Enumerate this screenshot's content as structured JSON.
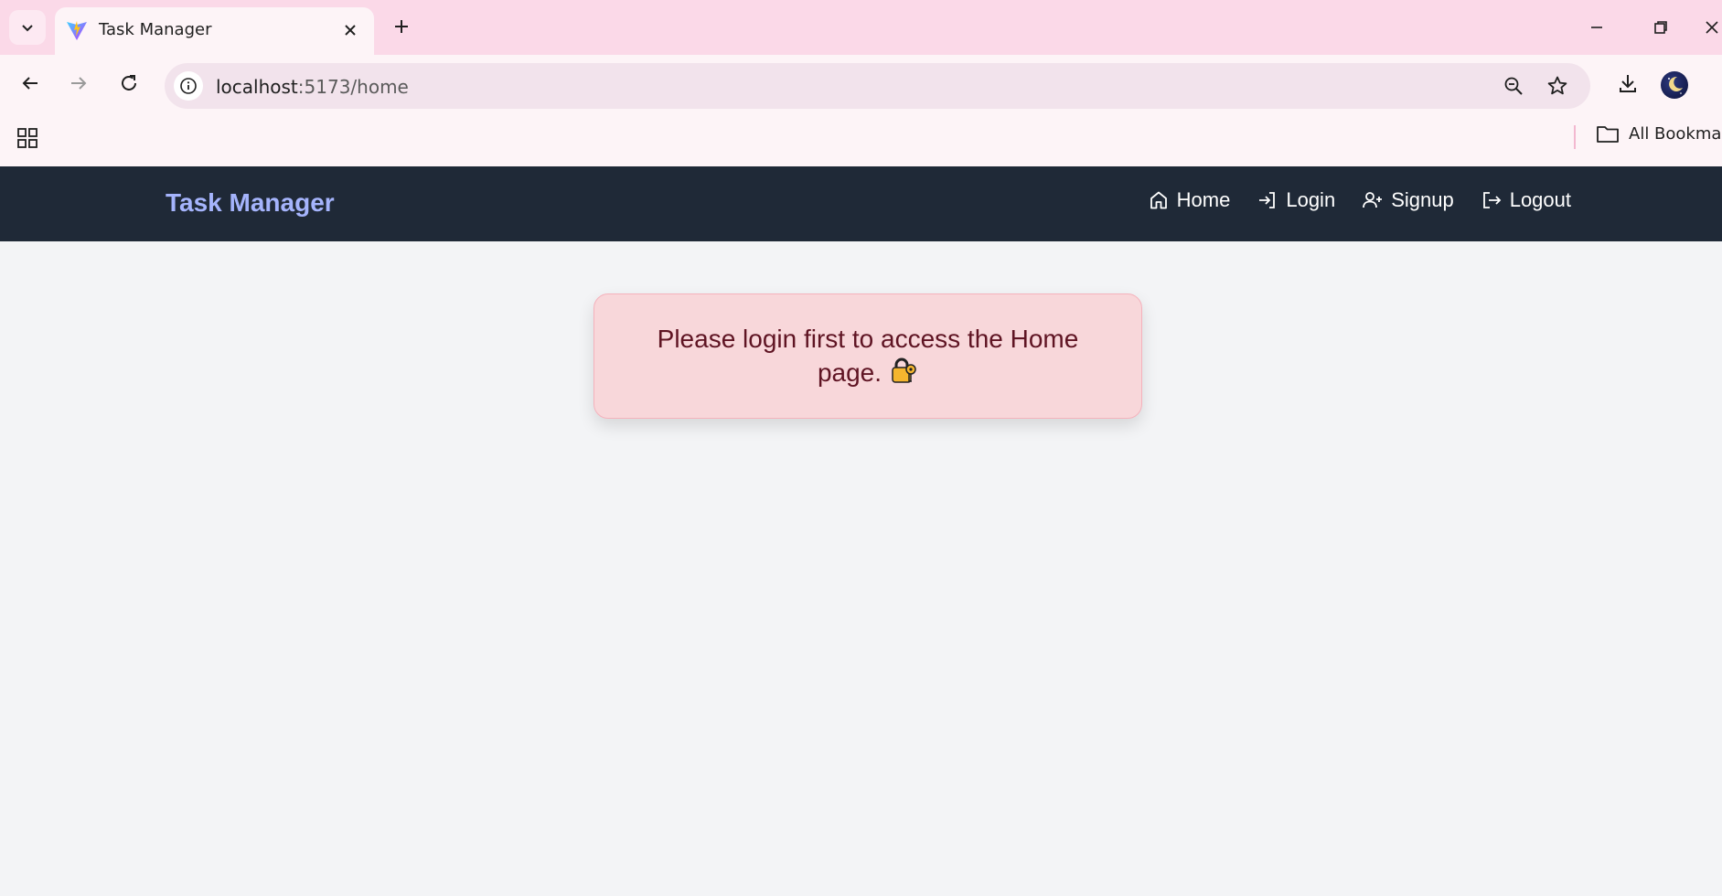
{
  "browser": {
    "tab": {
      "title": "Task Manager"
    },
    "address": {
      "host": "localhost",
      "path": ":5173/home"
    },
    "bookmarks": {
      "all_bookmarks_label": "All Bookmar"
    }
  },
  "app": {
    "brand": "Task Manager",
    "nav": [
      {
        "label": "Home",
        "icon": "home-icon"
      },
      {
        "label": "Login",
        "icon": "login-icon"
      },
      {
        "label": "Signup",
        "icon": "user-plus-icon"
      },
      {
        "label": "Logout",
        "icon": "logout-icon"
      }
    ],
    "alert": {
      "message": "Please login first to access the Home page.",
      "icon": "lock-key-emoji"
    }
  },
  "colors": {
    "navbar_bg": "#1f2937",
    "brand": "#a5b4fc",
    "alert_bg": "#f8d7da",
    "alert_text": "#5f1423",
    "page_bg": "#f3f4f6"
  }
}
